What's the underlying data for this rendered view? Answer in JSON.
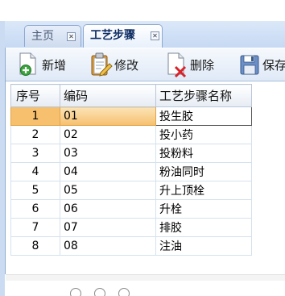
{
  "tabs": [
    {
      "label": "主页",
      "active": false
    },
    {
      "label": "工艺步骤",
      "active": true
    }
  ],
  "toolbar": {
    "add_label": "新增",
    "edit_label": "修改",
    "delete_label": "删除",
    "save_label": "保存"
  },
  "table": {
    "headers": [
      "序号",
      "编码",
      "工艺步骤名称"
    ],
    "selected_row": 0,
    "rows": [
      [
        "1",
        "01",
        "投生胶"
      ],
      [
        "2",
        "02",
        "投小药"
      ],
      [
        "3",
        "03",
        "投粉料"
      ],
      [
        "4",
        "04",
        "粉油同时"
      ],
      [
        "5",
        "05",
        "升上顶栓"
      ],
      [
        "6",
        "06",
        "升栓"
      ],
      [
        "7",
        "07",
        "排胶"
      ],
      [
        "8",
        "08",
        "注油"
      ]
    ]
  },
  "colors": {
    "selected_row": "#f6c06f",
    "tab_bar": "#cbdcf2"
  }
}
